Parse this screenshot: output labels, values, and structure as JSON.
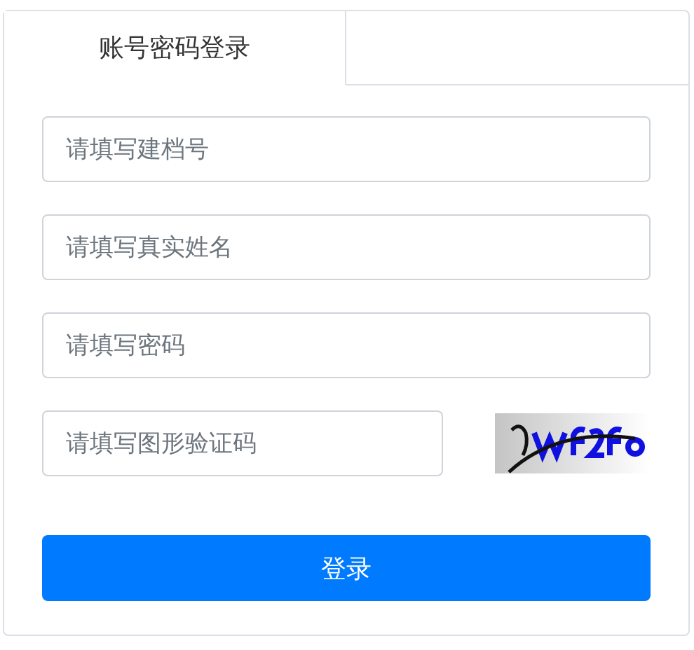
{
  "tabs": [
    {
      "label": "账号密码登录",
      "selected": true
    }
  ],
  "fields": [
    {
      "placeholder": "请填写建档号",
      "kind": "text"
    },
    {
      "placeholder": "请填写真实姓名",
      "kind": "text"
    },
    {
      "placeholder": "请填写密码",
      "kind": "password"
    },
    {
      "placeholder": "请填写图形验证码",
      "kind": "captcha"
    }
  ],
  "submit_button": "登录"
}
